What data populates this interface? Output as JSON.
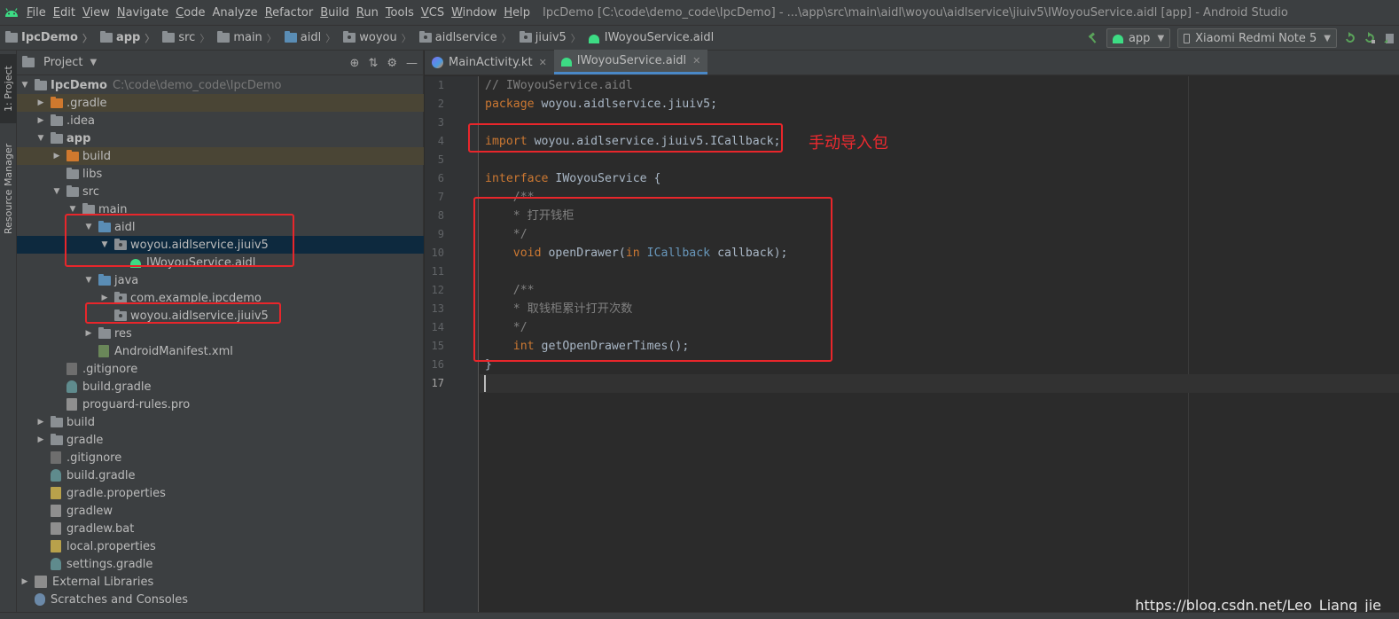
{
  "menubar": {
    "items": [
      {
        "mnemonic": "F",
        "rest": "ile"
      },
      {
        "mnemonic": "E",
        "rest": "dit"
      },
      {
        "mnemonic": "V",
        "rest": "iew"
      },
      {
        "mnemonic": "N",
        "rest": "avigate"
      },
      {
        "mnemonic": "C",
        "rest": "ode"
      },
      {
        "mnemonic": "",
        "rest": "Analyze"
      },
      {
        "mnemonic": "R",
        "rest": "efactor"
      },
      {
        "mnemonic": "B",
        "rest": "uild"
      },
      {
        "mnemonic": "R",
        "rest": "un"
      },
      {
        "mnemonic": "T",
        "rest": "ools"
      },
      {
        "mnemonic": "V",
        "rest": "CS"
      },
      {
        "mnemonic": "W",
        "rest": "indow"
      },
      {
        "mnemonic": "H",
        "rest": "elp"
      }
    ],
    "window_title": "IpcDemo [C:\\code\\demo_code\\IpcDemo] - ...\\app\\src\\main\\aidl\\woyou\\aidlservice\\jiuiv5\\IWoyouService.aidl [app] - Android Studio"
  },
  "navbar": {
    "crumbs": [
      "IpcDemo",
      "app",
      "src",
      "main",
      "aidl",
      "woyou",
      "aidlservice",
      "jiuiv5",
      "IWoyouService.aidl"
    ],
    "run_config": "app",
    "device": "Xiaomi Redmi Note 5"
  },
  "left_stripe": {
    "project_tab": "1: Project",
    "resource_tab": "Resource Manager"
  },
  "project_panel": {
    "title": "Project",
    "root_name": "IpcDemo",
    "root_path": "C:\\code\\demo_code\\IpcDemo",
    "items": [
      ".gradle",
      ".idea",
      "app",
      "build",
      "libs",
      "src",
      "main",
      "aidl",
      "woyou.aidlservice.jiuiv5",
      "IWoyouService.aidl",
      "java",
      "com.example.ipcdemo",
      "woyou.aidlservice.jiuiv5",
      "res",
      "AndroidManifest.xml",
      ".gitignore",
      "build.gradle",
      "proguard-rules.pro",
      "build",
      "gradle",
      ".gitignore",
      "build.gradle",
      "gradle.properties",
      "gradlew",
      "gradlew.bat",
      "local.properties",
      "settings.gradle",
      "External Libraries",
      "Scratches and Consoles"
    ]
  },
  "editor": {
    "tabs": [
      {
        "label": "MainActivity.kt"
      },
      {
        "label": "IWoyouService.aidl"
      }
    ],
    "line_numbers": [
      "1",
      "2",
      "3",
      "4",
      "5",
      "6",
      "7",
      "8",
      "9",
      "10",
      "11",
      "12",
      "13",
      "14",
      "15",
      "16",
      "17"
    ],
    "code": {
      "l1": "// IWoyouService.aidl",
      "l2_kw": "package",
      "l2_rest": " woyou.aidlservice.jiuiv5;",
      "l4_kw": "import",
      "l4_rest": " woyou.aidlservice.jiuiv5.ICallback;",
      "l6_kw": "interface",
      "l6_rest": " IWoyouService {",
      "l7": "    /**",
      "l8": "    * 打开钱柜",
      "l9": "    */",
      "l10_kw": "void",
      "l10_a": " openDrawer(",
      "l10_in": "in",
      "l10_sp": " ",
      "l10_type": "ICallback",
      "l10_b": " callback);",
      "l12": "    /**",
      "l13": "    * 取钱柜累计打开次数",
      "l14": "    */",
      "l15_kw": "int",
      "l15_rest": " getOpenDrawerTimes();",
      "l16": "}"
    }
  },
  "annotation": {
    "text": "手动导入包"
  },
  "watermark": "https://blog.csdn.net/Leo_Liang_jie",
  "colors": {
    "background": "#2b2b2b",
    "panel": "#3c3f41",
    "keyword": "#cc7832",
    "comment": "#808080",
    "type": "#6897bb",
    "annotation_red": "#e8262b",
    "android_green": "#3ddc84"
  }
}
